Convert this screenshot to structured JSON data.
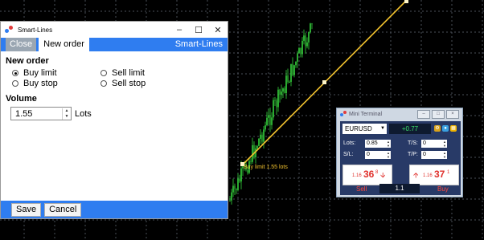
{
  "chart": {
    "line_label": "Buy limit 1.55 lots",
    "colors": {
      "background": "#000000",
      "grid": "#4a4f58",
      "bull": "#35d13c",
      "bear": "#2a9a2e",
      "line": "#f2c22e"
    }
  },
  "dialog": {
    "title": "Smart-Lines",
    "tabs": {
      "close": "Close",
      "new_order": "New order"
    },
    "brand": "Smart-Lines",
    "section_order": "New order",
    "options": {
      "buy_limit": "Buy limit",
      "sell_limit": "Sell limit",
      "buy_stop": "Buy stop",
      "sell_stop": "Sell stop",
      "selected": "buy_limit"
    },
    "section_volume": "Volume",
    "volume_value": "1.55",
    "volume_unit": "Lots",
    "buttons": {
      "save": "Save",
      "cancel": "Cancel"
    },
    "accent": "#2f7df0",
    "icons": {
      "app": "smart-lines-logo-icon",
      "minimize": "minimize-icon",
      "maximize": "maximize-icon",
      "close": "close-icon"
    }
  },
  "mini_terminal": {
    "title": "Mini Terminal",
    "symbol": "EURUSD",
    "change": "+0.77",
    "lots_label": "Lots:",
    "lots_value": "0.85",
    "ts_label": "T/S:",
    "ts_value": "0",
    "sl_label": "S/L:",
    "sl_value": "0",
    "tp_label": "T/P:",
    "tp_value": "0",
    "sell": {
      "prefix": "1.16",
      "big": "36",
      "small": "8",
      "label": "Sell"
    },
    "buy": {
      "prefix": "1.16",
      "big": "37",
      "small": "1",
      "label": "Buy"
    },
    "trade_lots": "1.1"
  }
}
